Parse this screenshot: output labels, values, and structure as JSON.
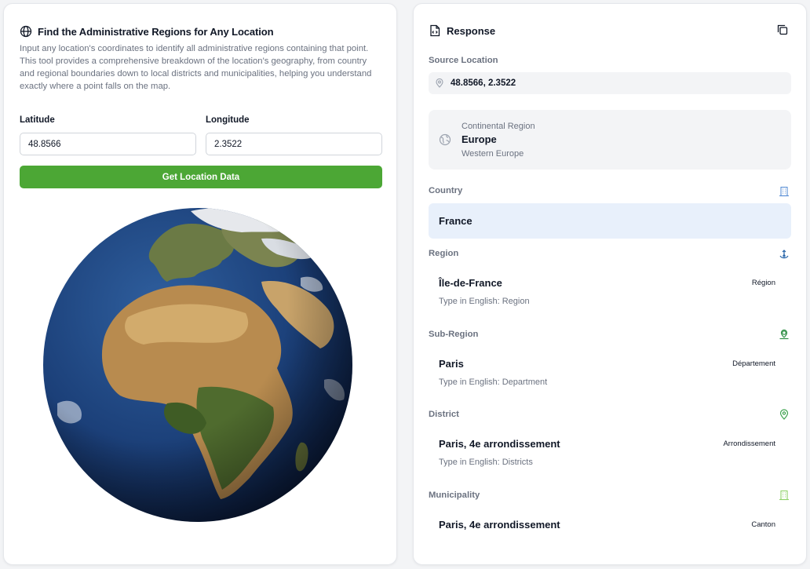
{
  "left": {
    "title": "Find the Administrative Regions for Any Location",
    "description": "Input any location's coordinates to identify all administrative regions containing that point. This tool provides a comprehensive breakdown of the location's geography, from country and regional boundaries down to local districts and municipalities, helping you understand exactly where a point falls on the map.",
    "latitude_label": "Latitude",
    "latitude_value": "48.8566",
    "longitude_label": "Longitude",
    "longitude_value": "2.3522",
    "button_label": "Get Location Data",
    "colors": {
      "button": "#4ca735"
    }
  },
  "response": {
    "title": "Response",
    "source_label": "Source Location",
    "source_value": "48.8566, 2.3522",
    "continental": {
      "label": "Continental Region",
      "value": "Europe",
      "sub": "Western Europe"
    },
    "country": {
      "label": "Country",
      "value": "France"
    },
    "region": {
      "label": "Region",
      "name": "Île-de-France",
      "badge": "Région",
      "type": "Type in English: Region"
    },
    "subregion": {
      "label": "Sub-Region",
      "name": "Paris",
      "badge": "Département",
      "type": "Type in English: Department"
    },
    "district": {
      "label": "District",
      "name": "Paris, 4e arrondissement",
      "badge": "Arrondissement",
      "type": "Type in English: Districts"
    },
    "municipality": {
      "label": "Municipality",
      "name": "Paris, 4e arrondissement",
      "badge": "Canton"
    },
    "icons": {
      "country": "building-icon",
      "region": "landmark-icon",
      "subregion": "map-person-icon",
      "district": "map-pin-icon",
      "municipality": "building-icon"
    }
  }
}
